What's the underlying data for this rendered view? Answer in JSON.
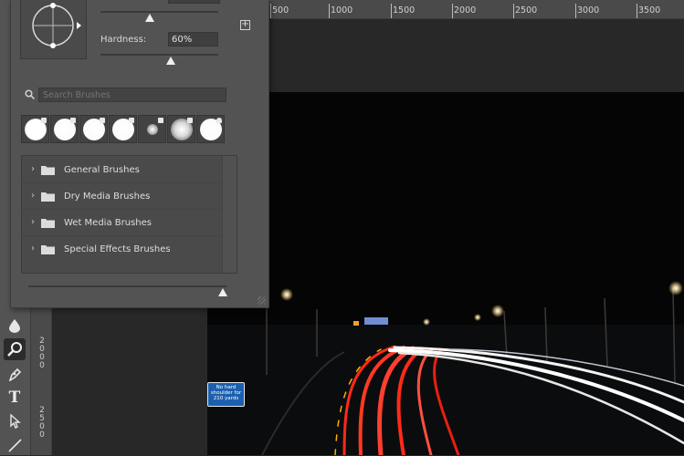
{
  "brush_panel": {
    "hardness_label": "Hardness:",
    "hardness_value": "60%",
    "hardness_level": 0.6,
    "size_level": 0.98,
    "new_preset_symbol": "+",
    "search_placeholder": "Search Brushes",
    "groups": [
      {
        "label": "General Brushes",
        "icon": "folder-icon"
      },
      {
        "label": "Dry Media Brushes",
        "icon": "folder-icon"
      },
      {
        "label": "Wet Media Brushes",
        "icon": "folder-icon"
      },
      {
        "label": "Special Effects Brushes",
        "icon": "folder-icon"
      }
    ],
    "recent_tips": [
      "soft-round",
      "hard-round",
      "hard-round",
      "hard-round",
      "airbrush-soft",
      "soft-round-large",
      "hard-round-pressure"
    ]
  },
  "toolbar": {
    "tools": [
      "blur-tool-icon",
      "zoom-tool-icon",
      "pen-tool-icon",
      "type-tool-icon",
      "path-selection-icon",
      "line-tool-icon"
    ],
    "active_tool": "zoom-tool-icon",
    "type_glyph": "T"
  },
  "rulers": {
    "horizontal": [
      "500",
      "1000",
      "1500",
      "2000",
      "2500",
      "3000",
      "3500"
    ],
    "vertical": [
      "2000",
      "2500"
    ]
  },
  "canvas": {
    "sign_lines": [
      "No hard",
      "shoulder for",
      "210 yards"
    ]
  },
  "colors": {
    "panel_bg": "#535353",
    "workspace_bg": "#282828",
    "taillights": "#ff2a1a",
    "headlights": "#ffffff",
    "sign_blue": "#1b5fb0"
  }
}
